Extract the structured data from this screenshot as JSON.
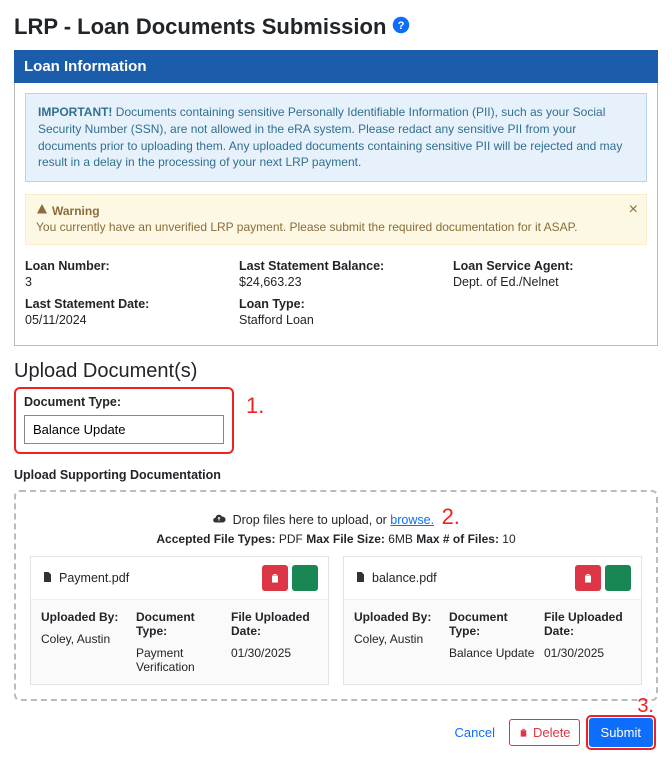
{
  "page": {
    "title": "LRP - Loan Documents Submission"
  },
  "panel": {
    "header": "Loan Information"
  },
  "important": {
    "label": "IMPORTANT!",
    "text": "Documents containing sensitive Personally Identifiable Information (PII), such as your Social Security Number (SSN), are not allowed in the eRA system. Please redact any sensitive PII from your documents prior to uploading them. Any uploaded documents containing sensitive PII will be rejected and may result in a delay in the processing of your next LRP payment."
  },
  "warning": {
    "title": "Warning",
    "text": "You currently have an unverified LRP payment. Please submit the required documentation for it ASAP."
  },
  "loan": {
    "number_label": "Loan Number:",
    "number": "3",
    "stmt_date_label": "Last Statement Date:",
    "stmt_date": "05/11/2024",
    "balance_label": "Last Statement Balance:",
    "balance": "$24,663.23",
    "type_label": "Loan Type:",
    "type": "Stafford Loan",
    "agent_label": "Loan Service Agent:",
    "agent": "Dept. of Ed./Nelnet"
  },
  "upload": {
    "section_title": "Upload Document(s)",
    "doc_type_label": "Document Type:",
    "doc_type_value": "Balance Update",
    "support_title": "Upload Supporting Documentation",
    "drop_prefix": "Drop files here to upload, or ",
    "browse": "browse.",
    "accepted_label": "Accepted File Types:",
    "accepted_value": " PDF ",
    "max_size_label": "Max File Size:",
    "max_size_value": " 6MB ",
    "max_files_label": "Max # of Files:",
    "max_files_value": " 10"
  },
  "files": [
    {
      "name": "Payment.pdf",
      "uploaded_by_label": "Uploaded By:",
      "uploaded_by": "Coley, Austin",
      "doc_type_label": "Document Type:",
      "doc_type": "Payment Verification",
      "date_label": "File Uploaded Date:",
      "date": "01/30/2025"
    },
    {
      "name": "balance.pdf",
      "uploaded_by_label": "Uploaded By:",
      "uploaded_by": "Coley, Austin",
      "doc_type_label": "Document Type:",
      "doc_type": "Balance Update",
      "date_label": "File Uploaded Date:",
      "date": "01/30/2025"
    }
  ],
  "footer": {
    "cancel": "Cancel",
    "delete": "Delete",
    "submit": "Submit"
  },
  "annotations": {
    "one": "1.",
    "two": "2.",
    "three": "3."
  }
}
